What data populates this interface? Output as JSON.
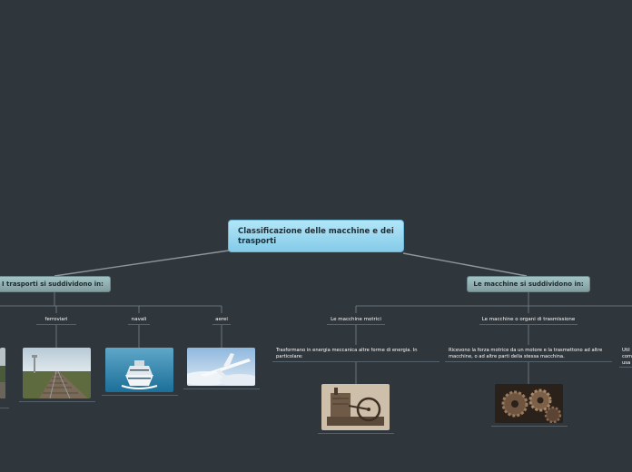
{
  "root": {
    "title": "Classificazione delle macchine e dei trasporti"
  },
  "left": {
    "heading": "I trasporti si suddividono in:",
    "items": [
      {
        "label": "ferroviari",
        "image": "railway-track-photo"
      },
      {
        "label": "navali",
        "image": "cruise-ship-photo"
      },
      {
        "label": "aerei",
        "image": "airplane-photo"
      }
    ]
  },
  "right": {
    "heading": "Le macchine si suddividono in:",
    "items": [
      {
        "label": "Le macchine motrici",
        "description": "Trasformano in energia meccanica altre forme di energia. In particolare:",
        "image": "steam-engine-photo"
      },
      {
        "label": "Le macchine o organi di trasmissione",
        "description": "Ricevono la forza motrice da un motore e la trasmettono ad altre macchine, o ad altre parti della stessa macchina.",
        "image": "gears-photo"
      }
    ],
    "partial_desc": "Util com usa"
  },
  "colors": {
    "background": "#2f363c",
    "root": "#8fd3ee",
    "sub": "#93b4b5",
    "line": "#8c969c"
  }
}
